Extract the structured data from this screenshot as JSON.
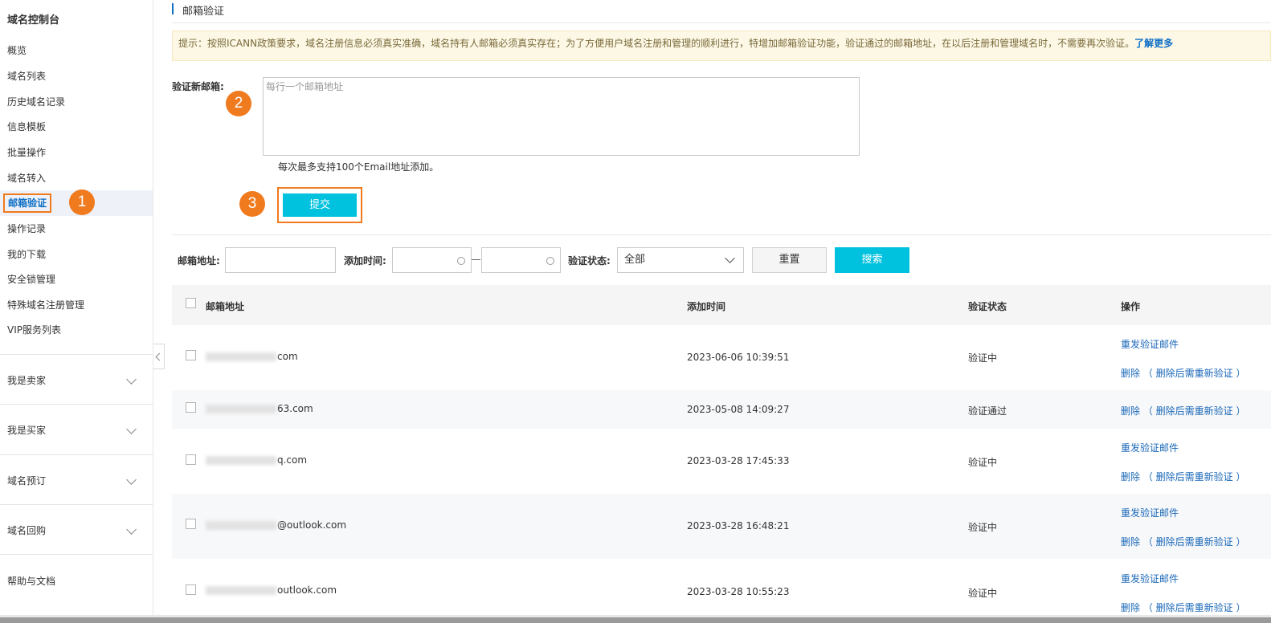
{
  "sidebar": {
    "title": "域名控制台",
    "items": [
      {
        "label": "概览"
      },
      {
        "label": "域名列表"
      },
      {
        "label": "历史域名记录"
      },
      {
        "label": "信息模板"
      },
      {
        "label": "批量操作"
      },
      {
        "label": "域名转入"
      },
      {
        "label": "邮箱验证",
        "active": true
      },
      {
        "label": "操作记录"
      },
      {
        "label": "我的下载"
      },
      {
        "label": "安全锁管理"
      },
      {
        "label": "特殊域名注册管理"
      },
      {
        "label": "VIP服务列表"
      }
    ],
    "groups": [
      {
        "label": "我是卖家"
      },
      {
        "label": "我是买家"
      },
      {
        "label": "域名预订"
      },
      {
        "label": "域名回购"
      }
    ],
    "help": "帮助与文档"
  },
  "badges": [
    "1",
    "2",
    "3"
  ],
  "page": {
    "title": "邮箱验证",
    "notice": "提示：按照ICANN政策要求，域名注册信息必须真实准确，域名持有人邮箱必须真实存在；为了方便用户域名注册和管理的顺利进行，特增加邮箱验证功能，验证通过的邮箱地址，在以后注册和管理域名时，不需要再次验证。",
    "notice_link": "了解更多"
  },
  "verify_form": {
    "label": "验证新邮箱:",
    "placeholder": "每行一个邮箱地址",
    "hint": "每次最多支持100个Email地址添加。",
    "submit_label": "提交"
  },
  "filters": {
    "email_label": "邮箱地址:",
    "time_label": "添加时间:",
    "status_label": "验证状态:",
    "status_value": "全部",
    "reset_label": "重置",
    "search_label": "搜索"
  },
  "table": {
    "columns": [
      "邮箱地址",
      "添加时间",
      "验证状态",
      "操作"
    ],
    "rows": [
      {
        "email": "com",
        "time": "2023-06-06 10:39:51",
        "status": "验证中",
        "actions": [
          "重发验证邮件",
          "删除 （ 删除后需重新验证 ）"
        ]
      },
      {
        "email": "63.com",
        "time": "2023-05-08 14:09:27",
        "status": "验证通过",
        "actions": [
          "删除 （ 删除后需重新验证 ）"
        ]
      },
      {
        "email": "q.com",
        "time": "2023-03-28 17:45:33",
        "status": "验证中",
        "actions": [
          "重发验证邮件",
          "删除 （ 删除后需重新验证 ）"
        ]
      },
      {
        "email": "@outlook.com",
        "time": "2023-03-28 16:48:21",
        "status": "验证中",
        "actions": [
          "重发验证邮件",
          "删除 （ 删除后需重新验证 ）"
        ]
      },
      {
        "email": "outlook.com",
        "time": "2023-03-28 10:55:23",
        "status": "验证中",
        "actions": [
          "重发验证邮件",
          "删除 （ 删除后需重新验证 ）"
        ]
      }
    ]
  },
  "colors": {
    "accent": "#00c1de",
    "highlight": "#f07a1e",
    "link": "#1a68b8"
  }
}
